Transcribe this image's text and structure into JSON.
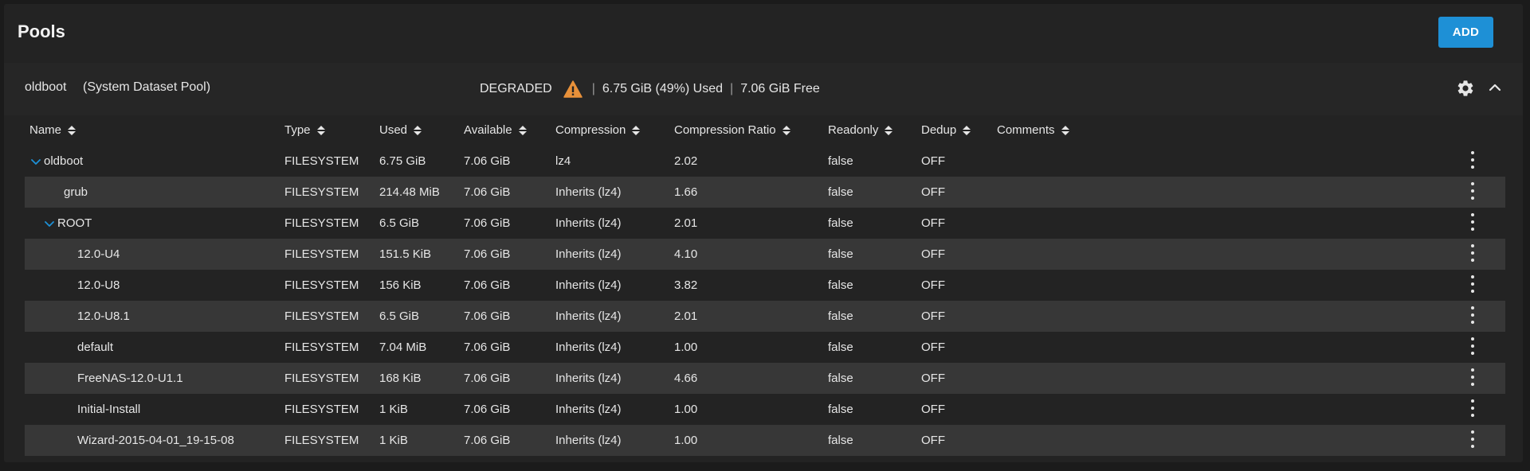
{
  "page": {
    "title": "Pools",
    "add_label": "ADD"
  },
  "pool": {
    "name": "oldboot",
    "subtitle": "(System Dataset Pool)",
    "status": "DEGRADED",
    "used": "6.75 GiB (49%) Used",
    "free": "7.06 GiB Free",
    "separator": "|",
    "icons": {
      "status": "warning-icon",
      "settings": "gear-icon",
      "collapse": "chevron-up-icon"
    }
  },
  "colors": {
    "accent": "#1e90d6",
    "warning": "#e8913a",
    "row_alt": "#373737",
    "card": "#232323"
  },
  "columns": [
    "Name",
    "Type",
    "Used",
    "Available",
    "Compression",
    "Compression Ratio",
    "Readonly",
    "Dedup",
    "Comments"
  ],
  "rows": [
    {
      "name": "oldboot",
      "expandable": true,
      "type": "FILESYSTEM",
      "used": "6.75 GiB",
      "available": "7.06 GiB",
      "compression": "lz4",
      "ratio": "2.02",
      "readonly": "false",
      "dedup": "OFF",
      "comments": ""
    },
    {
      "name": "grub",
      "expandable": false,
      "type": "FILESYSTEM",
      "used": "214.48 MiB",
      "available": "7.06 GiB",
      "compression": "Inherits (lz4)",
      "ratio": "1.66",
      "readonly": "false",
      "dedup": "OFF",
      "comments": ""
    },
    {
      "name": "ROOT",
      "expandable": true,
      "type": "FILESYSTEM",
      "used": "6.5 GiB",
      "available": "7.06 GiB",
      "compression": "Inherits (lz4)",
      "ratio": "2.01",
      "readonly": "false",
      "dedup": "OFF",
      "comments": ""
    },
    {
      "name": "12.0-U4",
      "expandable": false,
      "type": "FILESYSTEM",
      "used": "151.5 KiB",
      "available": "7.06 GiB",
      "compression": "Inherits (lz4)",
      "ratio": "4.10",
      "readonly": "false",
      "dedup": "OFF",
      "comments": ""
    },
    {
      "name": "12.0-U8",
      "expandable": false,
      "type": "FILESYSTEM",
      "used": "156 KiB",
      "available": "7.06 GiB",
      "compression": "Inherits (lz4)",
      "ratio": "3.82",
      "readonly": "false",
      "dedup": "OFF",
      "comments": ""
    },
    {
      "name": "12.0-U8.1",
      "expandable": false,
      "type": "FILESYSTEM",
      "used": "6.5 GiB",
      "available": "7.06 GiB",
      "compression": "Inherits (lz4)",
      "ratio": "2.01",
      "readonly": "false",
      "dedup": "OFF",
      "comments": ""
    },
    {
      "name": "default",
      "expandable": false,
      "type": "FILESYSTEM",
      "used": "7.04 MiB",
      "available": "7.06 GiB",
      "compression": "Inherits (lz4)",
      "ratio": "1.00",
      "readonly": "false",
      "dedup": "OFF",
      "comments": ""
    },
    {
      "name": "FreeNAS-12.0-U1.1",
      "expandable": false,
      "type": "FILESYSTEM",
      "used": "168 KiB",
      "available": "7.06 GiB",
      "compression": "Inherits (lz4)",
      "ratio": "4.66",
      "readonly": "false",
      "dedup": "OFF",
      "comments": ""
    },
    {
      "name": "Initial-Install",
      "expandable": false,
      "type": "FILESYSTEM",
      "used": "1 KiB",
      "available": "7.06 GiB",
      "compression": "Inherits (lz4)",
      "ratio": "1.00",
      "readonly": "false",
      "dedup": "OFF",
      "comments": ""
    },
    {
      "name": "Wizard-2015-04-01_19-15-08",
      "expandable": false,
      "type": "FILESYSTEM",
      "used": "1 KiB",
      "available": "7.06 GiB",
      "compression": "Inherits (lz4)",
      "ratio": "1.00",
      "readonly": "false",
      "dedup": "OFF",
      "comments": ""
    }
  ]
}
